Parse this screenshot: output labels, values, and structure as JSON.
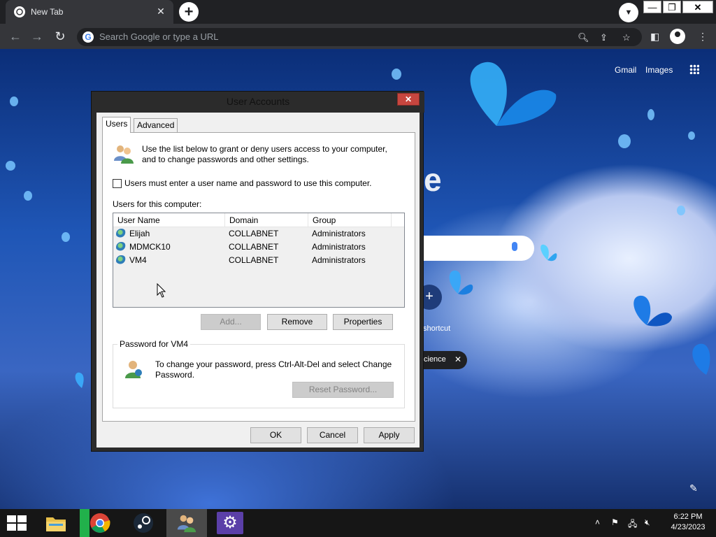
{
  "browser": {
    "tab_title": "New Tab",
    "omnibox_placeholder": "Search Google or type a URL",
    "links": {
      "gmail": "Gmail",
      "images": "Images"
    },
    "shortcut_label": "shortcut",
    "chip_text": "cience"
  },
  "dialog": {
    "title": "User Accounts",
    "tabs": [
      {
        "label": "Users"
      },
      {
        "label": "Advanced"
      }
    ],
    "intro": "Use the list below to grant or deny users access to your computer, and to change passwords and other settings.",
    "checkbox_label": "Users must enter a user name and password to use this computer.",
    "list_label": "Users for this computer:",
    "columns": [
      "User Name",
      "Domain",
      "Group"
    ],
    "users": [
      {
        "name": "Elijah",
        "domain": "COLLABNET",
        "group": "Administrators"
      },
      {
        "name": "MDMCK10",
        "domain": "COLLABNET",
        "group": "Administrators"
      },
      {
        "name": "VM4",
        "domain": "COLLABNET",
        "group": "Administrators"
      }
    ],
    "buttons": {
      "add": "Add...",
      "remove": "Remove",
      "properties": "Properties",
      "reset": "Reset Password...",
      "ok": "OK",
      "cancel": "Cancel",
      "apply": "Apply"
    },
    "password_group_label": "Password for VM4",
    "password_text": "To change your password, press Ctrl-Alt-Del and select Change Password."
  },
  "taskbar": {
    "time": "6:22 PM",
    "date": "4/23/2023"
  }
}
